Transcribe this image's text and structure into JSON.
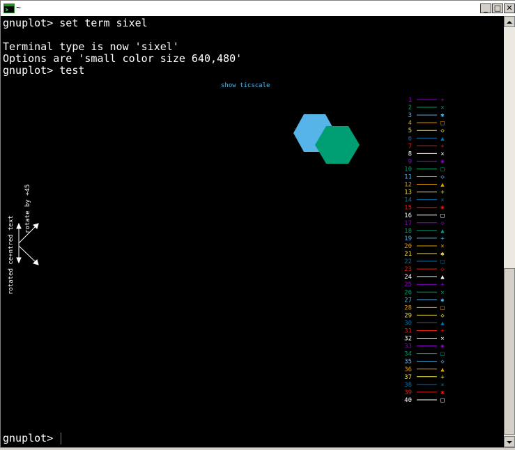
{
  "window": {
    "title": "~",
    "icon": "terminal-icon",
    "controls": {
      "minimize": "_",
      "maximize": "□",
      "close": "✕"
    }
  },
  "terminal": {
    "lines": [
      "gnuplot> set term sixel",
      "",
      "Terminal type is now 'sixel'",
      "Options are 'small color size 640,480'",
      "gnuplot> test"
    ],
    "prompt": "gnuplot> "
  },
  "plot": {
    "title": "show ticscale",
    "rotated_label": "rotated ce+ntred text",
    "rotate_label": "rotate by +45",
    "hexagon_colors": [
      "#56b4e9",
      "#009e73"
    ],
    "legend": [
      {
        "n": "1",
        "color": "#9400d3",
        "sym": "+"
      },
      {
        "n": "2",
        "color": "#009e73",
        "sym": "×"
      },
      {
        "n": "3",
        "color": "#56b4e9",
        "sym": "✱"
      },
      {
        "n": "4",
        "color": "#e69f00",
        "sym": "□"
      },
      {
        "n": "5",
        "color": "#f0e442",
        "sym": "◇"
      },
      {
        "n": "6",
        "color": "#0072b2",
        "sym": "▲"
      },
      {
        "n": "7",
        "color": "#e51e10",
        "sym": "+"
      },
      {
        "n": "8",
        "color": "#ffffff",
        "sym": "×"
      },
      {
        "n": "9",
        "color": "#9400d3",
        "sym": "✱"
      },
      {
        "n": "10",
        "color": "#009e73",
        "sym": "□"
      },
      {
        "n": "11",
        "color": "#56b4e9",
        "sym": "◇"
      },
      {
        "n": "12",
        "color": "#e69f00",
        "sym": "▲"
      },
      {
        "n": "13",
        "color": "#f0e442",
        "sym": "+"
      },
      {
        "n": "14",
        "color": "#0072b2",
        "sym": "×"
      },
      {
        "n": "15",
        "color": "#e51e10",
        "sym": "✱"
      },
      {
        "n": "16",
        "color": "#ffffff",
        "sym": "□"
      },
      {
        "n": "17",
        "color": "#9400d3",
        "sym": "◇"
      },
      {
        "n": "18",
        "color": "#009e73",
        "sym": "▲"
      },
      {
        "n": "19",
        "color": "#56b4e9",
        "sym": "+"
      },
      {
        "n": "20",
        "color": "#e69f00",
        "sym": "×"
      },
      {
        "n": "21",
        "color": "#f0e442",
        "sym": "✱"
      },
      {
        "n": "22",
        "color": "#0072b2",
        "sym": "□"
      },
      {
        "n": "23",
        "color": "#e51e10",
        "sym": "◇"
      },
      {
        "n": "24",
        "color": "#ffffff",
        "sym": "▲"
      },
      {
        "n": "25",
        "color": "#9400d3",
        "sym": "+"
      },
      {
        "n": "26",
        "color": "#009e73",
        "sym": "×"
      },
      {
        "n": "27",
        "color": "#56b4e9",
        "sym": "✱"
      },
      {
        "n": "28",
        "color": "#e69f00",
        "sym": "□"
      },
      {
        "n": "29",
        "color": "#f0e442",
        "sym": "◇"
      },
      {
        "n": "30",
        "color": "#0072b2",
        "sym": "▲"
      },
      {
        "n": "31",
        "color": "#e51e10",
        "sym": "+"
      },
      {
        "n": "32",
        "color": "#ffffff",
        "sym": "×"
      },
      {
        "n": "33",
        "color": "#9400d3",
        "sym": "✱"
      },
      {
        "n": "34",
        "color": "#009e73",
        "sym": "□"
      },
      {
        "n": "35",
        "color": "#56b4e9",
        "sym": "◇"
      },
      {
        "n": "36",
        "color": "#e69f00",
        "sym": "▲"
      },
      {
        "n": "37",
        "color": "#f0e442",
        "sym": "+"
      },
      {
        "n": "38",
        "color": "#0072b2",
        "sym": "×"
      },
      {
        "n": "39",
        "color": "#e51e10",
        "sym": "✱"
      },
      {
        "n": "40",
        "color": "#ffffff",
        "sym": "□"
      }
    ]
  }
}
